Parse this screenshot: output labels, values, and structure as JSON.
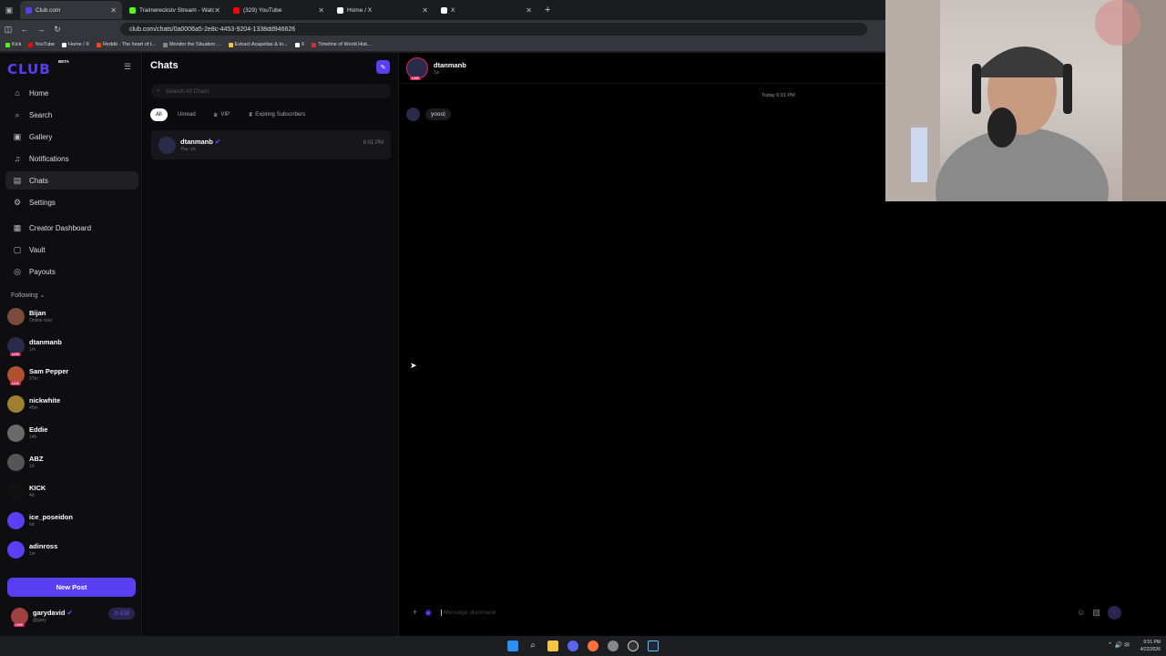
{
  "browser": {
    "tabs": [
      {
        "title": "Club.com",
        "active": true,
        "color": "#5b3ff5"
      },
      {
        "title": "Trainwreckstv Stream - Watch L",
        "active": false,
        "color": "#53fc18"
      },
      {
        "title": "(329) YouTube",
        "active": false,
        "color": "#ff0000"
      },
      {
        "title": "Home / X",
        "active": false,
        "color": "#ffffff"
      },
      {
        "title": "X",
        "active": false,
        "color": "#ffffff"
      }
    ],
    "url": "club.com/chats/0a0006a5-2e8c-4453-9204-1338dd946626",
    "bookmarks": [
      "Kick",
      "YouTube",
      "Home / X",
      "Reddit - The heart of t...",
      "Monitor the Situation ...",
      "Extract Acapellas & In...",
      "X",
      "Timeline of World Hist..."
    ]
  },
  "sidebar": {
    "logo": "CLUB",
    "beta": "BETA",
    "nav": [
      {
        "label": "Home",
        "icon": "home-icon",
        "glyph": "⌂"
      },
      {
        "label": "Search",
        "icon": "search-icon",
        "glyph": "⌕"
      },
      {
        "label": "Gallery",
        "icon": "gallery-icon",
        "glyph": "▣"
      },
      {
        "label": "Notifications",
        "icon": "bell-icon",
        "glyph": "♫"
      },
      {
        "label": "Chats",
        "icon": "chat-icon",
        "glyph": "▤"
      },
      {
        "label": "Settings",
        "icon": "gear-icon",
        "glyph": "⚙"
      },
      {
        "label": "Creator Dashboard",
        "icon": "dashboard-icon",
        "glyph": "▦"
      },
      {
        "label": "Vault",
        "icon": "vault-icon",
        "glyph": "▢"
      },
      {
        "label": "Payouts",
        "icon": "payouts-icon",
        "glyph": "◎"
      }
    ],
    "following_label": "Following",
    "following": [
      {
        "name": "Bijan",
        "sub": "Online now",
        "color": "#7a4a3a",
        "live": false
      },
      {
        "name": "dtanmanb",
        "sub": "1m",
        "color": "#2a2a4a",
        "live": true
      },
      {
        "name": "Sam Pepper",
        "sub": "27m",
        "color": "#b05030",
        "live": true
      },
      {
        "name": "nickwhite",
        "sub": "45m",
        "color": "#a08030",
        "live": false
      },
      {
        "name": "Eddie",
        "sub": "14h",
        "color": "#6a6a6a",
        "live": false
      },
      {
        "name": "ABZ",
        "sub": "1d",
        "color": "#555555",
        "live": false
      },
      {
        "name": "KICK",
        "sub": "4d",
        "color": "#111111",
        "live": false
      },
      {
        "name": "ice_poseidon",
        "sub": "6d",
        "color": "#5b3ff5",
        "live": false
      },
      {
        "name": "adinross",
        "sub": "1w",
        "color": "#5b3ff5",
        "live": false
      }
    ],
    "new_post": "New Post",
    "me": {
      "name": "garydavid",
      "handle": "@gary",
      "badge": "518"
    }
  },
  "chatlist": {
    "title": "Chats",
    "search_placeholder": "Search All Chats",
    "filters": [
      "All",
      "Unread",
      "VIP",
      "Expiring Subscribers"
    ],
    "chats": [
      {
        "name": "dtanmanb",
        "preview": "You: yo",
        "time": "6:01 PM"
      }
    ]
  },
  "conversation": {
    "name": "dtanmanb",
    "status": "1w",
    "date_separator": "Today 6:01 PM",
    "messages": [
      {
        "text": "yooo|"
      }
    ],
    "composer_placeholder": "Message dtanmanb"
  },
  "taskbar": {
    "time": "6:01 PM",
    "date": "4/22/2026"
  }
}
